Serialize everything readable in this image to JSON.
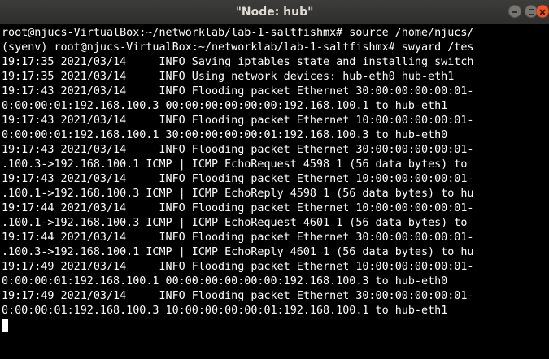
{
  "window": {
    "title": "\"Node: hub\""
  },
  "terminal": {
    "lines": [
      "root@njucs-VirtualBox:~/networklab/lab-1-saltfishmx# source /home/njucs/",
      "(syenv) root@njucs-VirtualBox:~/networklab/lab-1-saltfishmx# swyard /tes",
      "19:17:35 2021/03/14     INFO Saving iptables state and installing switch",
      "19:17:35 2021/03/14     INFO Using network devices: hub-eth0 hub-eth1",
      "19:17:43 2021/03/14     INFO Flooding packet Ethernet 30:00:00:00:00:01-",
      "0:00:00:01:192.168.100.3 00:00:00:00:00:00:192.168.100.1 to hub-eth1",
      "19:17:43 2021/03/14     INFO Flooding packet Ethernet 10:00:00:00:00:01-",
      "0:00:00:01:192.168.100.1 30:00:00:00:00:01:192.168.100.3 to hub-eth0",
      "19:17:43 2021/03/14     INFO Flooding packet Ethernet 30:00:00:00:00:01-",
      ".100.3->192.168.100.1 ICMP | ICMP EchoRequest 4598 1 (56 data bytes) to",
      "19:17:43 2021/03/14     INFO Flooding packet Ethernet 10:00:00:00:00:01-",
      ".100.1->192.168.100.3 ICMP | ICMP EchoReply 4598 1 (56 data bytes) to hu",
      "19:17:44 2021/03/14     INFO Flooding packet Ethernet 10:00:00:00:00:01-",
      ".100.1->192.168.100.3 ICMP | ICMP EchoRequest 4601 1 (56 data bytes) to",
      "19:17:44 2021/03/14     INFO Flooding packet Ethernet 30:00:00:00:00:01-",
      ".100.3->192.168.100.1 ICMP | ICMP EchoReply 4601 1 (56 data bytes) to hu",
      "19:17:49 2021/03/14     INFO Flooding packet Ethernet 10:00:00:00:00:01-",
      "0:00:00:01:192.168.100.1 00:00:00:00:00:00:192.168.100.3 to hub-eth0",
      "19:17:49 2021/03/14     INFO Flooding packet Ethernet 30:00:00:00:00:01-",
      "0:00:00:01:192.168.100.3 10:00:00:00:00:01:192.168.100.1 to hub-eth1"
    ]
  },
  "colors": {
    "terminal_bg": "#000000",
    "terminal_fg": "#ffffff",
    "titlebar_bg": "#3c3c3a",
    "close_button": "#e9572c"
  },
  "icons": {
    "minimize": "minimize-icon",
    "maximize": "maximize-icon",
    "close": "close-icon"
  }
}
